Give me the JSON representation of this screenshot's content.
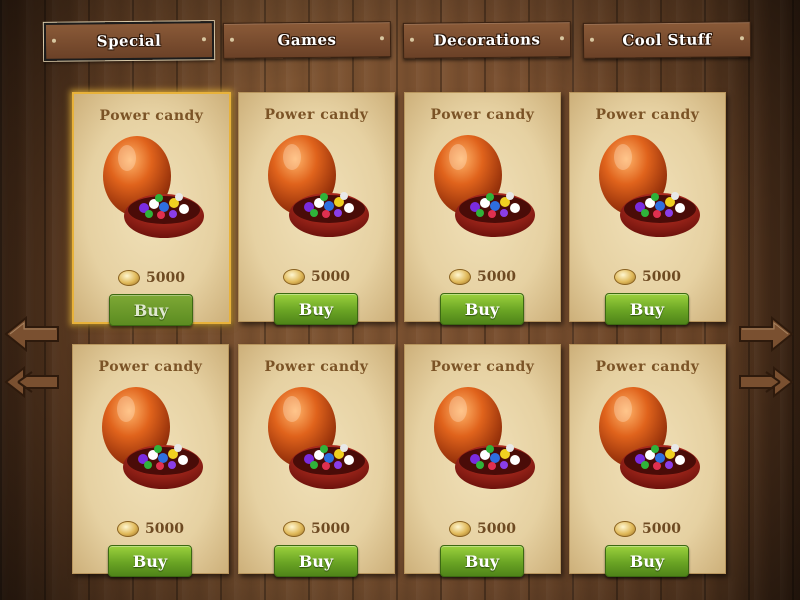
{
  "tabs": [
    {
      "label": "Special",
      "active": true
    },
    {
      "label": "Games",
      "active": false
    },
    {
      "label": "Decorations",
      "active": false
    },
    {
      "label": "Cool Stuff",
      "active": false
    }
  ],
  "items": [
    {
      "title": "Power candy",
      "price": "5000",
      "buy_label": "Buy",
      "selected": true
    },
    {
      "title": "Power candy",
      "price": "5000",
      "buy_label": "Buy",
      "selected": false
    },
    {
      "title": "Power candy",
      "price": "5000",
      "buy_label": "Buy",
      "selected": false
    },
    {
      "title": "Power candy",
      "price": "5000",
      "buy_label": "Buy",
      "selected": false
    },
    {
      "title": "Power candy",
      "price": "5000",
      "buy_label": "Buy",
      "selected": false
    },
    {
      "title": "Power candy",
      "price": "5000",
      "buy_label": "Buy",
      "selected": false
    },
    {
      "title": "Power candy",
      "price": "5000",
      "buy_label": "Buy",
      "selected": false
    },
    {
      "title": "Power candy",
      "price": "5000",
      "buy_label": "Buy",
      "selected": false
    }
  ],
  "icons": {
    "item": "candy-egg-icon",
    "coin": "coin-icon",
    "prev_page": "arrow-left-icon",
    "prev_all": "double-arrow-left-icon",
    "next_page": "arrow-right-icon",
    "next_all": "double-arrow-right-icon"
  },
  "colors": {
    "wood": "#7a5030",
    "parchment": "#ebd6a8",
    "title_text": "#7b5326",
    "buy_button": "#6aa424",
    "selected_outline": "#e8b23a"
  }
}
